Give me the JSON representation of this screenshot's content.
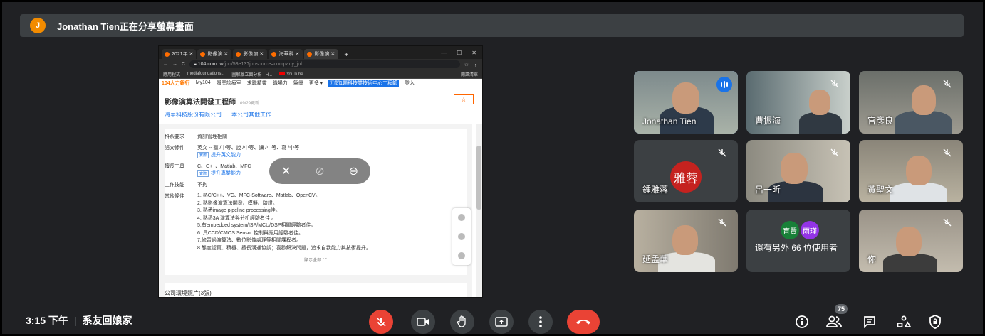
{
  "presenter": {
    "initial": "J",
    "text": "Jonathan Tien正在分享螢幕畫面"
  },
  "browser": {
    "tabs": [
      "2021年 ✕",
      "影像演 ✕",
      "影像演 ✕",
      "海華科 ✕",
      "影像演 ✕"
    ],
    "new_tab": "+",
    "url_host": "104.com.tw",
    "url_path": "/job/53e13?jobsource=company_job",
    "bookmarks": [
      "應用程式",
      "mediafoundations...",
      "圖解離立面分析 - H...",
      "YouTube",
      "閱讀清單"
    ],
    "site_brand": "104人力銀行",
    "site_nav": [
      "My104",
      "履歷診療室",
      "求職精靈",
      "職場力",
      "筆優",
      "更多 ▾"
    ],
    "site_notice": "⑪問1題科技業技術中心工程師",
    "site_login": "登入"
  },
  "job": {
    "title": "影像演算法開發工程師",
    "updated": "09/29更新",
    "company": "海華科技股份有限公司",
    "company_other": "本公司其他工作",
    "fav_icon": "☆",
    "rows": [
      {
        "label": "科系要求",
        "value": "資訊管理相關"
      },
      {
        "label": "語文條件",
        "value": "英文 -- 聽 /中等、說 /中等、讀 /中等、寫 /中等",
        "tag": "實際",
        "link": "提升英文能力"
      },
      {
        "label": "擅長工具",
        "value": "C、C++、Matlab、MFC",
        "tag": "實際",
        "link": "提升專業能力"
      },
      {
        "label": "工作技能",
        "value": "不拘"
      }
    ],
    "other_label": "其他條件",
    "other_lines": [
      "1. 熟C/C++、VC、MFC-Software、Matlab、OpenCV。",
      "2. 熟影像演算法開發、模擬、驗證。",
      "3. 熟悉image pipeline processing佳。",
      "4. 熟悉3A 演算法與分析經驗者佳 。",
      "5.有embedded system/ISP/MCU/DSP相關經驗者佳。",
      "6. 具CCD/CMOS Sensor 控制與應用經驗者佳。",
      "7.修習過演算法、數位影像處理等相關課程者。",
      "8.態度認真、積極、擅長溝通協調；喜歡解決問題，追求自我能力與技術提升。"
    ],
    "show_all": "顯示全部 ﹀",
    "photos": "公司環境照片(3張)"
  },
  "participants": [
    {
      "name": "Jonathan Tien",
      "speaking": true
    },
    {
      "name": "曹振海"
    },
    {
      "name": "官彥良"
    },
    {
      "name": "鍾雅蓉",
      "avatar": "雅蓉",
      "avatar_color": "#c5221f"
    },
    {
      "name": "呂一昕"
    },
    {
      "name": "黃聖文"
    },
    {
      "name": "延孟華"
    },
    {
      "name": "還有另外 66 位使用者",
      "avatars": [
        "育賢",
        "雨瑾"
      ],
      "avatar_colors": [
        "#188038",
        "#9334e6"
      ]
    },
    {
      "name": "你"
    }
  ],
  "bottom": {
    "time": "3:15 下午",
    "divider": "|",
    "meeting": "系友回娘家",
    "people_count": "75"
  },
  "colors": {
    "background": "#202124",
    "tile": "#3c4043",
    "danger": "#ea4335",
    "accent": "#8ab4f8"
  }
}
